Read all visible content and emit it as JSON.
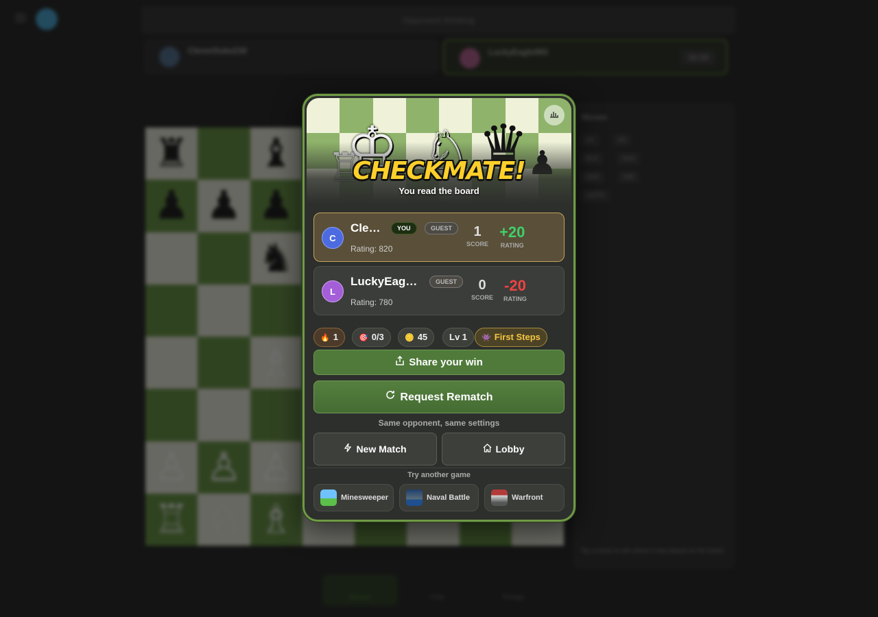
{
  "background": {
    "header_title": "Opponent thinking",
    "left_player": {
      "name": "CleverDuke230",
      "rating": "1h 00"
    },
    "right_player": {
      "name": "LuckyEagle993",
      "clock": "59:58",
      "rating": "1h 00"
    },
    "moves_title": "Moves",
    "moves": [
      [
        "e4",
        "e5"
      ],
      [
        "Bc4",
        "Nc6"
      ],
      [
        "Qh5",
        "Nf6"
      ],
      [
        "Qxf7#",
        ""
      ]
    ],
    "bottom_nav": [
      "Moves",
      "Chat",
      "Resign"
    ],
    "hint": "Tap a move to see where it was played on the board."
  },
  "modal": {
    "title": "CHECKMATE!",
    "subtitle": "You read the board",
    "players": [
      {
        "initial": "C",
        "name": "Cle…",
        "you_tag": "YOU",
        "guest_tag": "GUEST",
        "rating_text": "Rating: 820",
        "score": "1",
        "score_label": "SCORE",
        "delta": "+20",
        "delta_label": "RATING"
      },
      {
        "initial": "L",
        "name": "LuckyEag…",
        "guest_tag": "GUEST",
        "rating_text": "Rating: 780",
        "score": "0",
        "score_label": "SCORE",
        "delta": "-20",
        "delta_label": "RATING"
      }
    ],
    "chips": {
      "streak": "1",
      "goals": "0/3",
      "xp": "45",
      "level": "Lv 1",
      "achievement": "First Steps"
    },
    "share_label": "Share your win",
    "rematch_label": "Request Rematch",
    "rematch_note": "Same opponent, same settings",
    "new_match_label": "New Match",
    "lobby_label": "Lobby",
    "try_label": "Try another game",
    "games": [
      "Minesweeper",
      "Naval Battle",
      "Warfront"
    ]
  },
  "colors": {
    "accent": "#6f9a45",
    "positive": "#3fd06a",
    "negative": "#ef4343",
    "title": "#ffd02a"
  }
}
